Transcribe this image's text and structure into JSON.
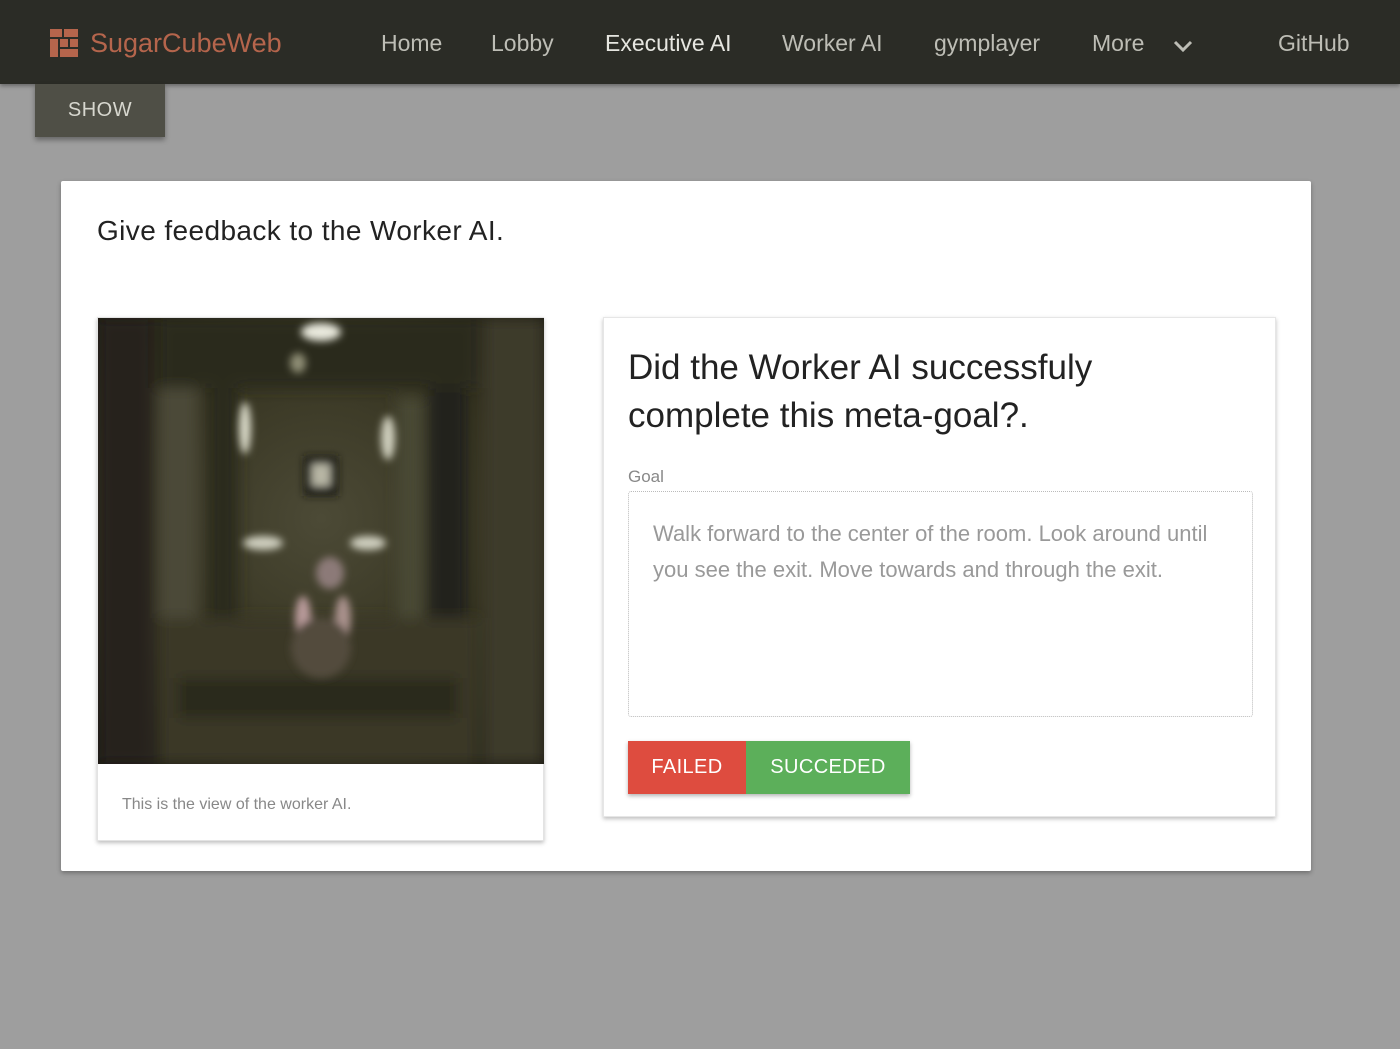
{
  "navbar": {
    "brand": "SugarCubeWeb",
    "items": [
      {
        "label": "Home",
        "active": false
      },
      {
        "label": "Lobby",
        "active": false
      },
      {
        "label": "Executive AI",
        "active": true
      },
      {
        "label": "Worker AI",
        "active": false
      },
      {
        "label": "gymplayer",
        "active": false
      },
      {
        "label": "More",
        "active": false,
        "icon": "chevron-down-icon"
      }
    ],
    "github": "GitHub"
  },
  "show_button": "SHOW",
  "main": {
    "title": "Give feedback to the Worker AI.",
    "image_card": {
      "caption": "This is the view of the worker AI."
    },
    "question_card": {
      "title": "Did the Worker AI successfuly complete this meta-goal?.",
      "goal_label": "Goal",
      "goal_text": "Walk forward to the center of the room. Look around until you see the exit. Move towards and through the exit.",
      "failed_label": "FAILED",
      "success_label": "SUCCEDED"
    }
  },
  "colors": {
    "navbar_bg": "#2b2c26",
    "brand": "#b5654c",
    "page_bg": "#9e9e9e",
    "failed": "#de4c3f",
    "success": "#5caf5a"
  }
}
